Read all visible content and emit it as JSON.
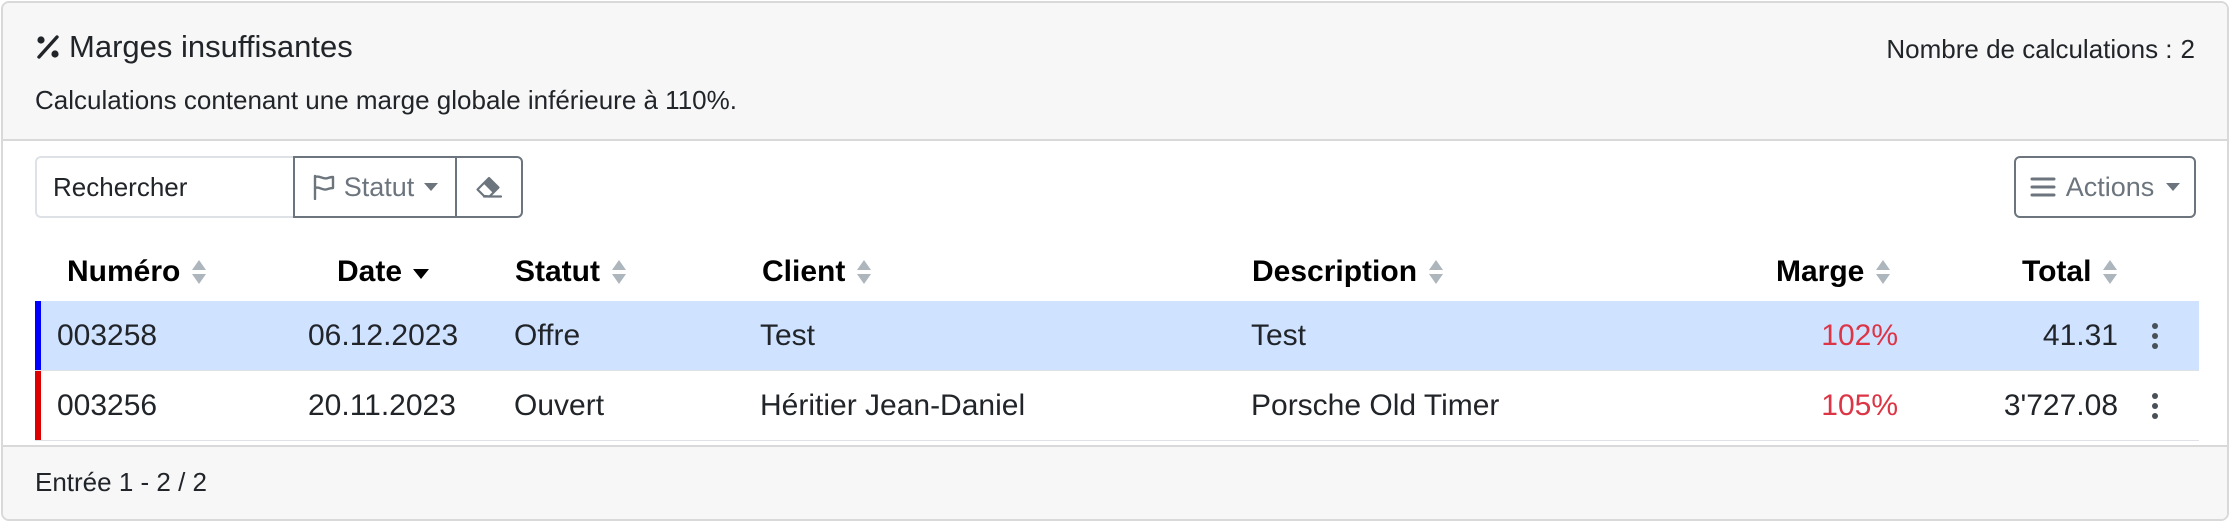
{
  "header": {
    "title": "Marges insuffisantes",
    "subtitle": "Calculations contenant une marge globale inférieure à 110%.",
    "count_label": "Nombre de calculations :",
    "count_value": "2"
  },
  "toolbar": {
    "search_placeholder": "Rechercher",
    "status_label": "Statut",
    "actions_label": "Actions"
  },
  "columns": [
    "Numéro",
    "Date",
    "Statut",
    "Client",
    "Description",
    "Marge",
    "Total"
  ],
  "sort_state": {
    "Date": "descending",
    "others": "unsorted"
  },
  "rows": [
    {
      "numero": "003258",
      "date": "06.12.2023",
      "statut": "Offre",
      "client": "Test",
      "description": "Test",
      "marge": "102%",
      "total": "41.31",
      "status_color": "#0000ff",
      "selected": true
    },
    {
      "numero": "003256",
      "date": "20.11.2023",
      "statut": "Ouvert",
      "client": "Héritier Jean-Daniel",
      "description": "Porsche Old Timer",
      "marge": "105%",
      "total": "3'727.08",
      "status_color": "#dc0000",
      "selected": false
    }
  ],
  "footer": {
    "entries": "Entrée 1 - 2 / 2"
  },
  "colors": {
    "selected_row": "#cfe2ff",
    "marge_text": "#dc3545",
    "header_bg": "#f7f7f7",
    "border": "#d9d9d9",
    "secondary": "#6c757d"
  },
  "icons": [
    "percent-icon",
    "flag-icon",
    "caret-down-icon",
    "eraser-icon",
    "bars-icon",
    "sort-icon",
    "kebab-menu-icon"
  ]
}
